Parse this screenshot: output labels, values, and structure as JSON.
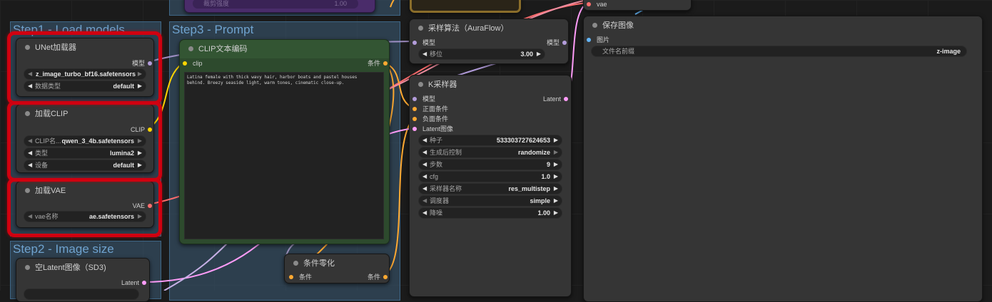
{
  "groups": {
    "step1": "Step1 - Load models",
    "step2": "Step2 - Image size",
    "step3": "Step3 - Prompt"
  },
  "unet": {
    "title": "UNet加载器",
    "out_model": "模型",
    "unet_name": "z_image_turbo_bf16.safetensors",
    "dtype_label": "数据类型",
    "dtype_value": "default"
  },
  "clip_loader": {
    "title": "加载CLIP",
    "out_clip": "CLIP",
    "clip_name_label": "CLIP名...",
    "clip_name_value": "qwen_3_4b.safetensors",
    "type_label": "类型",
    "type_value": "lumina2",
    "device_label": "设备",
    "device_value": "default"
  },
  "vae_loader": {
    "title": "加载VAE",
    "out_vae": "VAE",
    "vae_label": "vae名称",
    "vae_value": "ae.safetensors"
  },
  "empty_latent": {
    "title": "空Latent图像（SD3)",
    "out_latent": "Latent"
  },
  "clip_encode": {
    "title": "CLIP文本编码",
    "in_clip": "clip",
    "out_cond": "条件",
    "text": "Latina female with thick wavy hair, harbor boats and pastel houses\nbehind. Breezy seaside light, warm tones, cinematic close-up."
  },
  "cond_zero": {
    "title": "条件零化",
    "in_cond": "条件",
    "out_cond": "条件"
  },
  "sampling": {
    "title": "采样算法（AuraFlow）",
    "in_model": "模型",
    "out_model": "模型",
    "shift_label": "移位",
    "shift_value": "3.00"
  },
  "ksampler": {
    "title": "K采样器",
    "in_model": "模型",
    "in_positive": "正面条件",
    "in_negative": "负面条件",
    "in_latent": "Latent图像",
    "out_latent": "Latent",
    "seed_label": "种子",
    "seed_value": "533303727624653",
    "control_label": "生成后控制",
    "control_value": "randomize",
    "steps_label": "步数",
    "steps_value": "9",
    "cfg_label": "cfg",
    "cfg_value": "1.0",
    "sampler_label": "采样器名称",
    "sampler_value": "res_multistep",
    "scheduler_label": "调度器",
    "scheduler_value": "simple",
    "denoise_label": "降噪",
    "denoise_value": "1.00"
  },
  "decode": {
    "in_vae": "vae"
  },
  "save": {
    "title": "保存图像",
    "in_images": "图片",
    "prefix_label": "文件名前缀",
    "prefix_value": "z-image"
  },
  "top_widget": {
    "label": "裁剪强度",
    "value": "1.00"
  },
  "colors": {
    "model": "#b39ddb",
    "clip": "#ffd500",
    "vae": "#ff6e6e",
    "cond": "#ffa931",
    "latent": "#ff9cf9",
    "image": "#64b5f6",
    "highlight": "#d00010"
  }
}
